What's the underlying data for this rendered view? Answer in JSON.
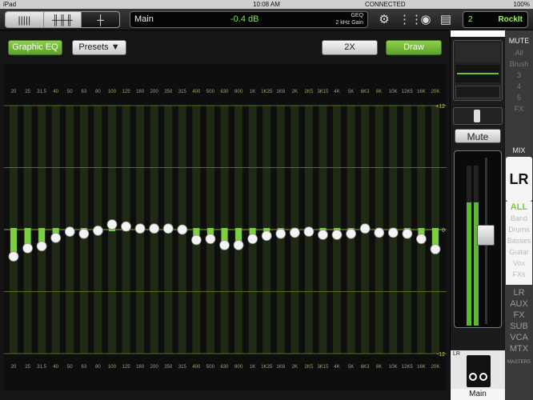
{
  "status": {
    "device": "iPad",
    "time": "10:08 AM",
    "connection": "CONNECTED",
    "battery": "100%"
  },
  "header": {
    "channel": "Main",
    "value": "-0.4 dB",
    "param1": "GEQ",
    "param2": "2 kHz Gain",
    "scene_num": "2",
    "scene_name": "RockIt"
  },
  "toolbar": {
    "graphic_eq": "Graphic EQ",
    "presets": "Presets ▼",
    "zoom": "2X",
    "draw": "Draw"
  },
  "eq": {
    "bands": [
      "20",
      "25",
      "31.5",
      "40",
      "50",
      "63",
      "80",
      "100",
      "125",
      "160",
      "200",
      "250",
      "315",
      "400",
      "500",
      "630",
      "800",
      "1K",
      "1K25",
      "1K6",
      "2K",
      "2K5",
      "3K15",
      "4K",
      "5K",
      "6K3",
      "8K",
      "10K",
      "12K5",
      "16K",
      "20K"
    ],
    "gains": [
      -2.6,
      -1.8,
      -1.6,
      -0.8,
      -0.2,
      -0.4,
      -0.1,
      0.5,
      0.3,
      0.1,
      0.1,
      0.1,
      0.0,
      -1.0,
      -0.9,
      -1.5,
      -1.5,
      -0.9,
      -0.6,
      -0.4,
      -0.3,
      -0.2,
      -0.5,
      -0.5,
      -0.4,
      0.1,
      -0.3,
      -0.3,
      -0.4,
      -0.9,
      -1.9
    ],
    "scale_top": "+12",
    "scale_bottom": "-12",
    "scale_zero": "0"
  },
  "strip": {
    "mute": "Mute",
    "lr": "LR",
    "main_label": "Main"
  },
  "mute_panel": {
    "title": "MUTE",
    "items": [
      "All",
      "Brush",
      "3",
      "4",
      "5",
      "FX"
    ]
  },
  "mix_panel": {
    "title": "MIX",
    "selected": "LR",
    "items": [
      "ALL",
      "Band",
      "Drums",
      "Basses",
      "Guitar",
      "Vox",
      "FXs"
    ]
  },
  "nav": {
    "items": [
      "LR",
      "AUX",
      "FX",
      "SUB",
      "VCA",
      "MTX"
    ],
    "footer": "MASTERS"
  },
  "colors": {
    "accent": "#8fd14f",
    "fader_bar": "#5a8a2e"
  }
}
